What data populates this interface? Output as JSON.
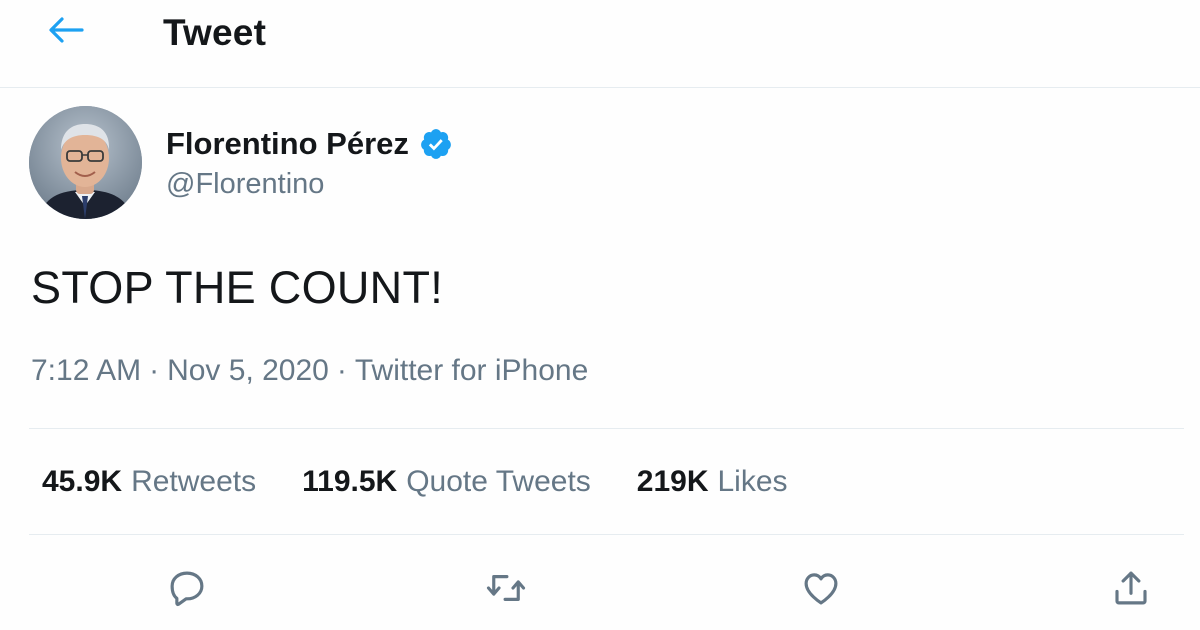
{
  "header": {
    "title": "Tweet",
    "back_icon": "arrow-left-icon",
    "accent_color": "#1da1f2"
  },
  "tweet": {
    "author": {
      "display_name": "Florentino Pérez",
      "handle": "@Florentino",
      "verified_icon": "verified-badge-icon"
    },
    "text": "STOP THE COUNT!",
    "time": "7:12 AM",
    "separator": "·",
    "date": "Nov 5, 2020",
    "source": "Twitter for iPhone"
  },
  "stats": {
    "retweets": {
      "count": "45.9K",
      "label": "Retweets"
    },
    "quote_tweets": {
      "count": "119.5K",
      "label": "Quote Tweets"
    },
    "likes": {
      "count": "219K",
      "label": "Likes"
    }
  },
  "actions": {
    "icons": [
      "reply-icon",
      "retweet-icon",
      "like-icon",
      "share-icon"
    ],
    "icon_color": "#657786"
  }
}
